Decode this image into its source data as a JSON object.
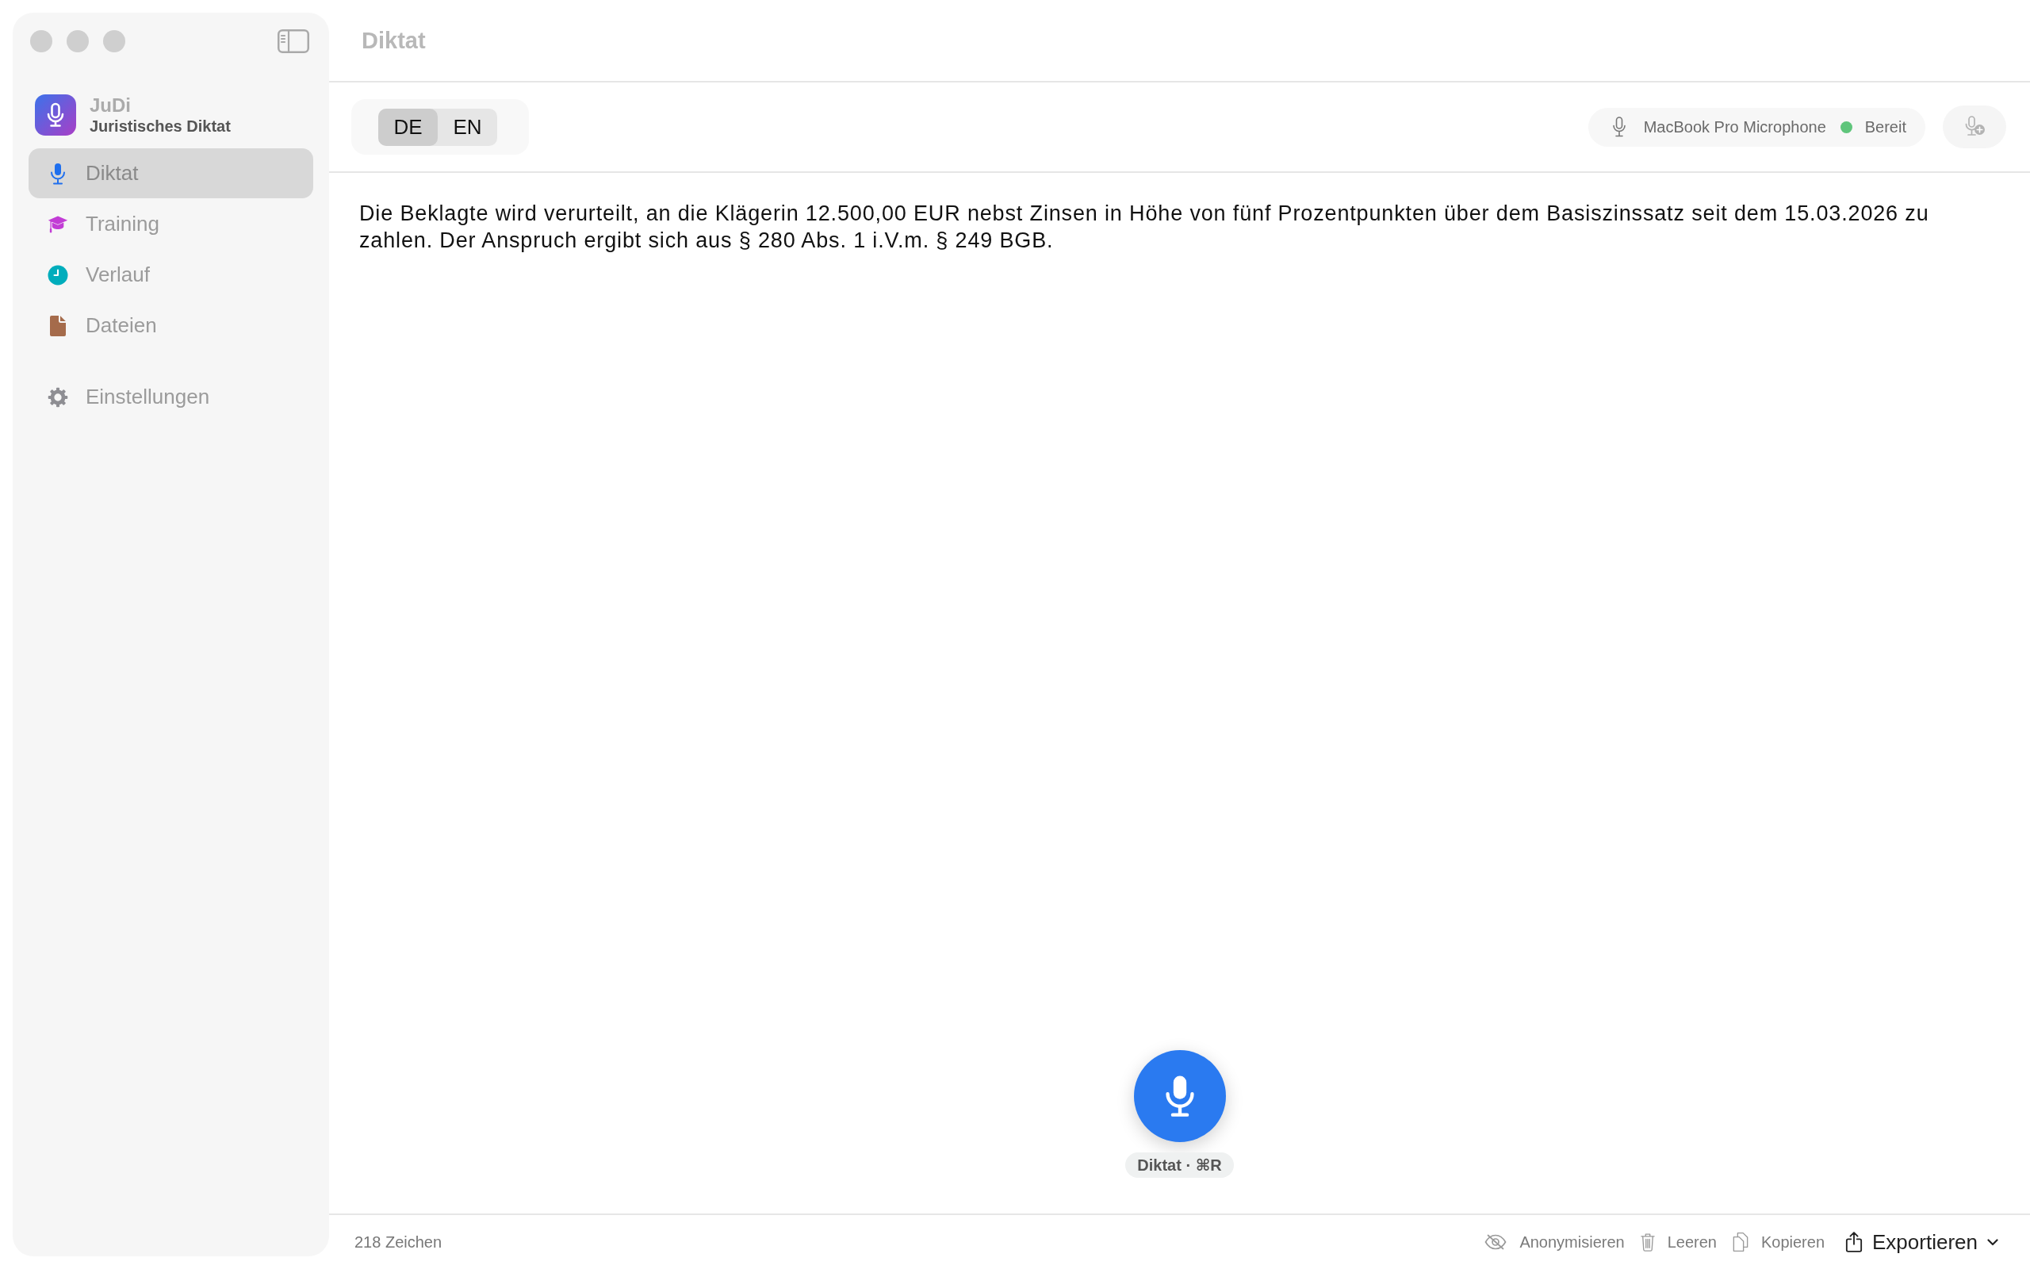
{
  "sidebar": {
    "app": {
      "name": "JuDi",
      "subtitle": "Juristisches Diktat"
    },
    "items": [
      {
        "label": "Diktat",
        "kind": "dictation",
        "selected": true
      },
      {
        "label": "Training",
        "kind": "training",
        "selected": false
      },
      {
        "label": "Verlauf",
        "kind": "history",
        "selected": false
      },
      {
        "label": "Dateien",
        "kind": "files",
        "selected": false
      }
    ],
    "footer_items": [
      {
        "label": "Einstellungen",
        "kind": "settings",
        "selected": false
      }
    ]
  },
  "window": {
    "title": "Diktat"
  },
  "toolbar": {
    "languages": [
      {
        "label": "DE",
        "selected": true
      },
      {
        "label": "EN",
        "selected": false
      }
    ],
    "microphone": {
      "device": "MacBook Pro Microphone",
      "status": "Bereit",
      "ready": true
    }
  },
  "editor": {
    "text": "Die Beklagte wird verurteilt, an die Klägerin 12.500,00 EUR nebst Zinsen in Höhe von fünf Prozentpunkten über dem Basiszinssatz seit dem 15.03.2026 zu zahlen. Der Anspruch ergibt sich aus § 280 Abs. 1 i.V.m. § 249 BGB."
  },
  "record_button": {
    "hint": "Diktat · ⌘R"
  },
  "status_bar": {
    "char_count": "218 Zeichen",
    "actions": [
      {
        "label": "Anonymisieren",
        "kind": "anonymize"
      },
      {
        "label": "Leeren",
        "kind": "clear"
      },
      {
        "label": "Kopieren",
        "kind": "copy"
      },
      {
        "label": "Exportieren",
        "kind": "export"
      }
    ]
  }
}
